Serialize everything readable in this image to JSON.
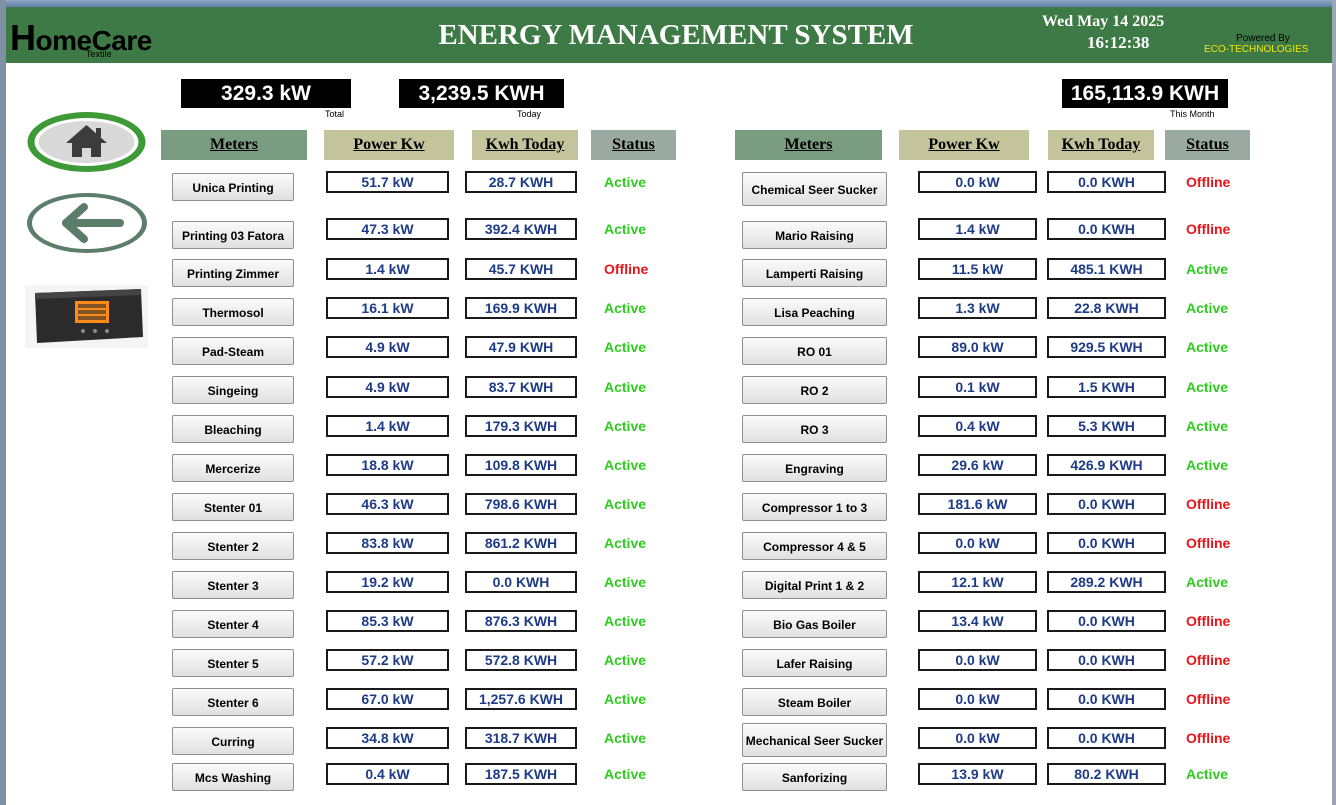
{
  "header": {
    "logo_first": "H",
    "logo_rest": "omeCare",
    "logo_sub": "Textile",
    "title": "ENERGY MANAGEMENT SYSTEM",
    "date": "Wed May 14 2025",
    "time": "16:12:38",
    "powered_by": "Powered By",
    "powered_name": "ECO-TECHNOLOGIES"
  },
  "kpis": {
    "total_value": "329.3 kW",
    "total_caption": "Total",
    "today_value": "3,239.5 KWH",
    "today_caption": "Today",
    "month_value": "165,113.9 KWH",
    "month_caption": "This Month"
  },
  "columns": {
    "meters": "Meters",
    "power": "Power Kw",
    "kwh": "Kwh Today",
    "status": "Status"
  },
  "colors": {
    "header_bg": "#3e7a45",
    "active": "#2ecc1f",
    "offline": "#e8141a",
    "value_text": "#1d3b86"
  },
  "icons": {
    "home": "home-icon",
    "back": "arrow-left-icon",
    "meter": "energy-meter-image"
  },
  "left_meters": [
    {
      "name": "Unica Printing",
      "power": "51.7 kW",
      "kwh": "28.7 KWH",
      "status": "Active"
    },
    {
      "name": "Printing 03 Fatora",
      "power": "47.3 kW",
      "kwh": "392.4 KWH",
      "status": "Active"
    },
    {
      "name": "Printing Zimmer",
      "power": "1.4 kW",
      "kwh": "45.7 KWH",
      "status": "Offline"
    },
    {
      "name": "Thermosol",
      "power": "16.1 kW",
      "kwh": "169.9 KWH",
      "status": "Active"
    },
    {
      "name": "Pad-Steam",
      "power": "4.9 kW",
      "kwh": "47.9 KWH",
      "status": "Active"
    },
    {
      "name": "Singeing",
      "power": "4.9 kW",
      "kwh": "83.7 KWH",
      "status": "Active"
    },
    {
      "name": "Bleaching",
      "power": "1.4 kW",
      "kwh": "179.3 KWH",
      "status": "Active"
    },
    {
      "name": "Mercerize",
      "power": "18.8 kW",
      "kwh": "109.8 KWH",
      "status": "Active"
    },
    {
      "name": "Stenter 01",
      "power": "46.3 kW",
      "kwh": "798.6 KWH",
      "status": "Active"
    },
    {
      "name": "Stenter 2",
      "power": "83.8 kW",
      "kwh": "861.2 KWH",
      "status": "Active"
    },
    {
      "name": "Stenter 3",
      "power": "19.2 kW",
      "kwh": "0.0 KWH",
      "status": "Active"
    },
    {
      "name": "Stenter 4",
      "power": "85.3 kW",
      "kwh": "876.3 KWH",
      "status": "Active"
    },
    {
      "name": "Stenter 5",
      "power": "57.2 kW",
      "kwh": "572.8 KWH",
      "status": "Active"
    },
    {
      "name": "Stenter 6",
      "power": "67.0 kW",
      "kwh": "1,257.6 KWH",
      "status": "Active"
    },
    {
      "name": "Curring",
      "power": "34.8 kW",
      "kwh": "318.7 KWH",
      "status": "Active"
    },
    {
      "name": "Mcs Washing",
      "power": "0.4 kW",
      "kwh": "187.5 KWH",
      "status": "Active"
    }
  ],
  "right_meters": [
    {
      "name": "Chemical Seer Sucker",
      "power": "0.0 kW",
      "kwh": "0.0 KWH",
      "status": "Offline"
    },
    {
      "name": "Mario Raising",
      "power": "1.4 kW",
      "kwh": "0.0 KWH",
      "status": "Offline"
    },
    {
      "name": "Lamperti Raising",
      "power": "11.5 kW",
      "kwh": "485.1 KWH",
      "status": "Active"
    },
    {
      "name": "Lisa Peaching",
      "power": "1.3 kW",
      "kwh": "22.8 KWH",
      "status": "Active"
    },
    {
      "name": "RO 01",
      "power": "89.0 kW",
      "kwh": "929.5 KWH",
      "status": "Active"
    },
    {
      "name": "RO 2",
      "power": "0.1 kW",
      "kwh": "1.5 KWH",
      "status": "Active"
    },
    {
      "name": "RO 3",
      "power": "0.4 kW",
      "kwh": "5.3 KWH",
      "status": "Active"
    },
    {
      "name": "Engraving",
      "power": "29.6 kW",
      "kwh": "426.9 KWH",
      "status": "Active"
    },
    {
      "name": "Compressor 1 to 3",
      "power": "181.6 kW",
      "kwh": "0.0 KWH",
      "status": "Offline"
    },
    {
      "name": "Compressor 4 & 5",
      "power": "0.0 kW",
      "kwh": "0.0 KWH",
      "status": "Offline"
    },
    {
      "name": "Digital Print 1 & 2",
      "power": "12.1 kW",
      "kwh": "289.2 KWH",
      "status": "Active"
    },
    {
      "name": "Bio Gas Boiler",
      "power": "13.4 kW",
      "kwh": "0.0 KWH",
      "status": "Offline"
    },
    {
      "name": "Lafer Raising",
      "power": "0.0 kW",
      "kwh": "0.0 KWH",
      "status": "Offline"
    },
    {
      "name": "Steam Boiler",
      "power": "0.0 kW",
      "kwh": "0.0 KWH",
      "status": "Offline"
    },
    {
      "name": "Mechanical Seer Sucker",
      "power": "0.0 kW",
      "kwh": "0.0 KWH",
      "status": "Offline"
    },
    {
      "name": "Sanforizing",
      "power": "13.9 kW",
      "kwh": "80.2 KWH",
      "status": "Active"
    }
  ]
}
